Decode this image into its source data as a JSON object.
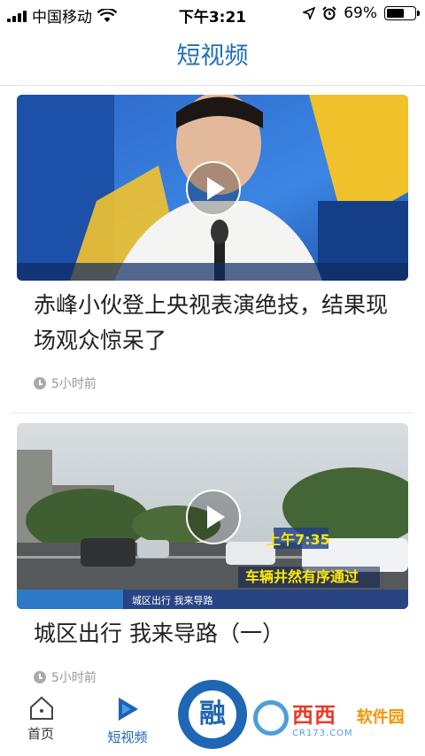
{
  "status_bar": {
    "carrier": "中国移动",
    "time": "下午3:21",
    "battery_percent_label": "69%",
    "battery_level": 0.69
  },
  "header": {
    "title": "短视频"
  },
  "feed": {
    "items": [
      {
        "title": "赤峰小伙登上央视表演绝技，结果现场观众惊呆了",
        "time_ago": "5小时前"
      },
      {
        "title": "城区出行 我来导路（一）",
        "time_ago": "5小时前",
        "overlay_time": "上午7:35",
        "overlay_caption": "车辆井然有序通过",
        "overlay_bottom_text": "城区出行 我来导路"
      }
    ]
  },
  "tabbar": {
    "tabs": [
      {
        "label": "首页",
        "icon": "home-icon"
      },
      {
        "label": "短视频",
        "icon": "video-play-icon",
        "active": true
      },
      {
        "label": "融",
        "icon": "center-logo"
      }
    ],
    "watermark": {
      "name": "西西",
      "tag": "软件园",
      "site": "CR173.COM"
    }
  },
  "colors": {
    "accent": "#1f6fb8",
    "active_tab": "#1e63b3"
  }
}
